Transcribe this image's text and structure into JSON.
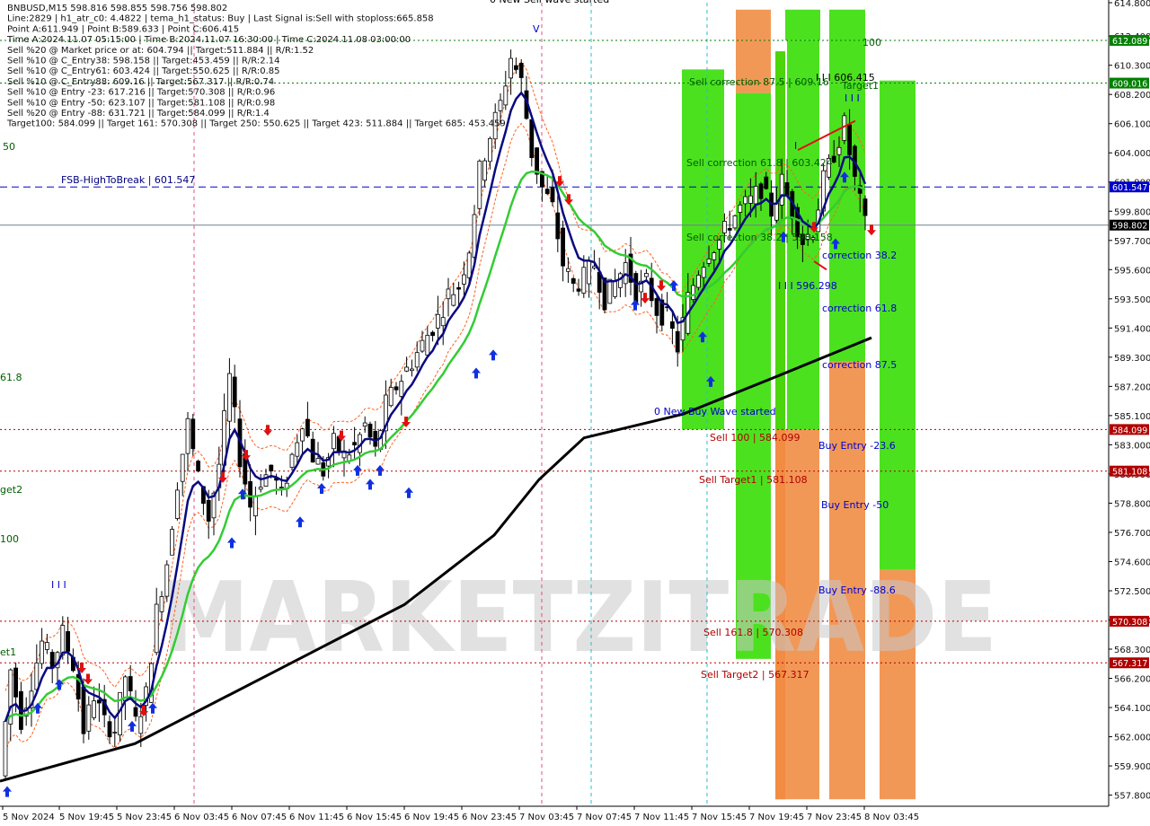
{
  "info_lines": [
    "BNBUSD,M15   598.816 598.855 598.756 598.802",
    "Line:2829 | h1_atr_c0: 4.4822 | tema_h1_status: Buy | Last Signal is:Sell with stoploss:665.858",
    "Point A:611.949 | Point B:589.633 | Point C:606.415",
    "Time A:2024.11.07 05:15:00 | Time B:2024.11.07 16:30:00 | Time C:2024.11.08 03:00:00",
    "Sell %20 @ Market price or at: 604.794 || Target:511.884 || R/R:1.52",
    "Sell %10 @ C_Entry38: 598.158 || Target:453.459 || R/R:2.14",
    "Sell %10 @ C_Entry61: 603.424 || Target:550.625 || R/R:0.85",
    "Sell %10 @ C_Entry88: 609.16 || Target:567.317 || R/R:0.74",
    "Sell %10 @ Entry -23: 617.216 || Target:570.308 || R/R:0.96",
    "Sell %10 @ Entry -50: 623.107 || Target:581.108 || R/R:0.98",
    "Sell %20 @ Entry -88: 631.721 || Target:584.099 || R/R:1.4",
    "Target100: 584.099 || Target 161: 570.308 || Target 250: 550.625 || Target 423: 511.884 || Target 685: 453.459"
  ],
  "watermark": "MARKETZITRADE",
  "colors": {
    "background": "#ffffff",
    "bull_candle": "#000000",
    "bear_candle": "#000000",
    "tema": "#0a0a80",
    "ema_green": "#33cc33",
    "ma_long": "#000000",
    "zone_green": "#33dd00",
    "zone_orange": "#f08a40",
    "up_arrow": "#1030e0",
    "down_arrow": "#e01010",
    "level_green": "#008000",
    "level_red": "#b00000",
    "level_blue": "#0000cc"
  },
  "chart_data": {
    "type": "candlestick",
    "symbol": "BNBUSD,M15",
    "ylim": [
      557.0,
      614.8
    ],
    "x_ticks": [
      "5 Nov 2024",
      "5 Nov 19:45",
      "5 Nov 23:45",
      "6 Nov 03:45",
      "6 Nov 07:45",
      "6 Nov 11:45",
      "6 Nov 15:45",
      "6 Nov 19:45",
      "6 Nov 23:45",
      "7 Nov 03:45",
      "7 Nov 07:45",
      "7 Nov 11:45",
      "7 Nov 15:45",
      "7 Nov 19:45",
      "7 Nov 23:45",
      "8 Nov 03:45"
    ],
    "y_ticks": [
      614.8,
      612.4,
      610.3,
      608.2,
      606.1,
      604.0,
      601.9,
      599.8,
      597.7,
      595.6,
      593.5,
      591.4,
      589.3,
      587.2,
      585.1,
      583.0,
      580.9,
      578.8,
      576.7,
      574.6,
      572.5,
      570.4,
      568.3,
      566.2,
      564.1,
      562.0,
      559.9,
      557.8
    ],
    "price_tags": [
      {
        "label": "612.089",
        "value": 612.089,
        "color": "#008000"
      },
      {
        "label": "609.016",
        "value": 609.016,
        "color": "#008000"
      },
      {
        "label": "601.547",
        "value": 601.547,
        "color": "#0000cc"
      },
      {
        "label": "598.802",
        "value": 598.802,
        "color": "#000000"
      },
      {
        "label": "584.099",
        "value": 584.099,
        "color": "#b00000"
      },
      {
        "label": "581.108",
        "value": 581.108,
        "color": "#b00000"
      },
      {
        "label": "570.308",
        "value": 570.308,
        "color": "#b00000"
      },
      {
        "label": "567.317",
        "value": 567.317,
        "color": "#b00000"
      }
    ],
    "levels": [
      {
        "value": 612.089,
        "color": "#008000",
        "dash": "2,3"
      },
      {
        "value": 609.016,
        "color": "#008000",
        "dash": "2,3"
      },
      {
        "value": 601.547,
        "color": "#0000cc",
        "dash": "8,5"
      },
      {
        "value": 598.802,
        "color": "#708090",
        "dash": ""
      },
      {
        "value": 584.099,
        "color": "#b00000",
        "dash": "2,3"
      },
      {
        "value": 581.108,
        "color": "#b00000",
        "dash": "2,3"
      },
      {
        "value": 570.308,
        "color": "#b00000",
        "dash": "2,3"
      },
      {
        "value": 567.317,
        "color": "#b00000",
        "dash": "2,3"
      }
    ],
    "annotations": [
      {
        "text": "FSB-HighToBreak | 601.547",
        "color": "#000080"
      },
      {
        "text": "Sell correction 87.5 | 609.16",
        "color": "#006000"
      },
      {
        "text": "Sell correction 61.8 | 603.424",
        "color": "#006000"
      },
      {
        "text": "Sell correction 38.2 | 598.158",
        "color": "#006000"
      },
      {
        "text": "I I I 606.415",
        "color": "#000000"
      },
      {
        "text": "I I I 596.298",
        "color": "#0000cc"
      },
      {
        "text": "Target1",
        "color": "#006000"
      },
      {
        "text": "100",
        "color": "#006000"
      },
      {
        "text": "correction 38.2",
        "color": "#0000cc"
      },
      {
        "text": "correction 61.8",
        "color": "#0000cc"
      },
      {
        "text": "correction 87.5",
        "color": "#0000cc"
      },
      {
        "text": "0 New Buy Wave started",
        "color": "#0000cc"
      },
      {
        "text": "Sell 100 | 584.099",
        "color": "#b00000"
      },
      {
        "text": "Sell Target1 | 581.108",
        "color": "#b00000"
      },
      {
        "text": "Buy Entry -23.6",
        "color": "#0000cc"
      },
      {
        "text": "Buy Entry -50",
        "color": "#0000cc"
      },
      {
        "text": "Buy Entry -88.6",
        "color": "#0000cc"
      },
      {
        "text": "Sell 161.8 | 570.308",
        "color": "#b00000"
      },
      {
        "text": "Sell Target2 | 567.317",
        "color": "#b00000"
      },
      {
        "text": "0 New Sell wave started",
        "color": "#000000"
      },
      {
        "text": "50",
        "color": "#006000"
      },
      {
        "text": "61.8",
        "color": "#006000"
      },
      {
        "text": "get2",
        "color": "#006000"
      },
      {
        "text": "100",
        "color": "#006000"
      },
      {
        "text": "et1",
        "color": "#006000"
      },
      {
        "text": "I I I",
        "color": "#0000cc"
      },
      {
        "text": "I",
        "color": "#0000cc"
      },
      {
        "text": "I I I",
        "color": "#0000cc"
      },
      {
        "text": "V",
        "color": "#0000cc"
      }
    ],
    "close_series": [
      {
        "t": 0,
        "c": 559.2
      },
      {
        "t": 2,
        "c": 566.8
      },
      {
        "t": 4,
        "c": 563.2
      },
      {
        "t": 6,
        "c": 566.0
      },
      {
        "t": 8,
        "c": 568.8
      },
      {
        "t": 10,
        "c": 567.2
      },
      {
        "t": 12,
        "c": 569.4
      },
      {
        "t": 14,
        "c": 567.2
      },
      {
        "t": 16,
        "c": 562.5
      },
      {
        "t": 18,
        "c": 565.0
      },
      {
        "t": 20,
        "c": 563.0
      },
      {
        "t": 22,
        "c": 562.5
      },
      {
        "t": 24,
        "c": 566.4
      },
      {
        "t": 26,
        "c": 563.0
      },
      {
        "t": 28,
        "c": 565.0
      },
      {
        "t": 30,
        "c": 571.0
      },
      {
        "t": 32,
        "c": 574.6
      },
      {
        "t": 34,
        "c": 580.4
      },
      {
        "t": 36,
        "c": 584.5
      },
      {
        "t": 38,
        "c": 580.5
      },
      {
        "t": 40,
        "c": 577.7
      },
      {
        "t": 42,
        "c": 581.6
      },
      {
        "t": 44,
        "c": 587.8
      },
      {
        "t": 46,
        "c": 582.1
      },
      {
        "t": 48,
        "c": 578.6
      },
      {
        "t": 50,
        "c": 580.5
      },
      {
        "t": 52,
        "c": 581.1
      },
      {
        "t": 54,
        "c": 579.3
      },
      {
        "t": 56,
        "c": 582.2
      },
      {
        "t": 58,
        "c": 584.9
      },
      {
        "t": 60,
        "c": 582.2
      },
      {
        "t": 62,
        "c": 581.1
      },
      {
        "t": 64,
        "c": 583.1
      },
      {
        "t": 66,
        "c": 582.2
      },
      {
        "t": 68,
        "c": 582.8
      },
      {
        "t": 70,
        "c": 584.4
      },
      {
        "t": 72,
        "c": 582.5
      },
      {
        "t": 74,
        "c": 585.9
      },
      {
        "t": 76,
        "c": 587.2
      },
      {
        "t": 78,
        "c": 588.4
      },
      {
        "t": 80,
        "c": 589.6
      },
      {
        "t": 82,
        "c": 590.9
      },
      {
        "t": 84,
        "c": 592.1
      },
      {
        "t": 86,
        "c": 593.8
      },
      {
        "t": 88,
        "c": 594.4
      },
      {
        "t": 90,
        "c": 597.2
      },
      {
        "t": 92,
        "c": 602.7
      },
      {
        "t": 94,
        "c": 605.3
      },
      {
        "t": 96,
        "c": 607.5
      },
      {
        "t": 98,
        "c": 610.9
      },
      {
        "t": 100,
        "c": 609.1
      },
      {
        "t": 102,
        "c": 604.0
      },
      {
        "t": 104,
        "c": 601.5
      },
      {
        "t": 106,
        "c": 600.0
      },
      {
        "t": 108,
        "c": 596.0
      },
      {
        "t": 110,
        "c": 594.4
      },
      {
        "t": 112,
        "c": 595.0
      },
      {
        "t": 114,
        "c": 596.0
      },
      {
        "t": 116,
        "c": 593.5
      },
      {
        "t": 118,
        "c": 594.7
      },
      {
        "t": 120,
        "c": 596.0
      },
      {
        "t": 122,
        "c": 594.0
      },
      {
        "t": 124,
        "c": 594.7
      },
      {
        "t": 126,
        "c": 592.7
      },
      {
        "t": 128,
        "c": 592.1
      },
      {
        "t": 130,
        "c": 590.0
      },
      {
        "t": 132,
        "c": 593.5
      },
      {
        "t": 134,
        "c": 595.6
      },
      {
        "t": 136,
        "c": 597.0
      },
      {
        "t": 138,
        "c": 597.7
      },
      {
        "t": 140,
        "c": 599.0
      },
      {
        "t": 142,
        "c": 600.0
      },
      {
        "t": 144,
        "c": 600.5
      },
      {
        "t": 146,
        "c": 601.5
      },
      {
        "t": 148,
        "c": 599.8
      },
      {
        "t": 150,
        "c": 601.9
      },
      {
        "t": 152,
        "c": 599.8
      },
      {
        "t": 154,
        "c": 597.7
      },
      {
        "t": 156,
        "c": 598.5
      },
      {
        "t": 158,
        "c": 602.0
      },
      {
        "t": 160,
        "c": 604.0
      },
      {
        "t": 162,
        "c": 606.0
      },
      {
        "t": 164,
        "c": 602.0
      },
      {
        "t": 166,
        "c": 598.8
      }
    ]
  }
}
